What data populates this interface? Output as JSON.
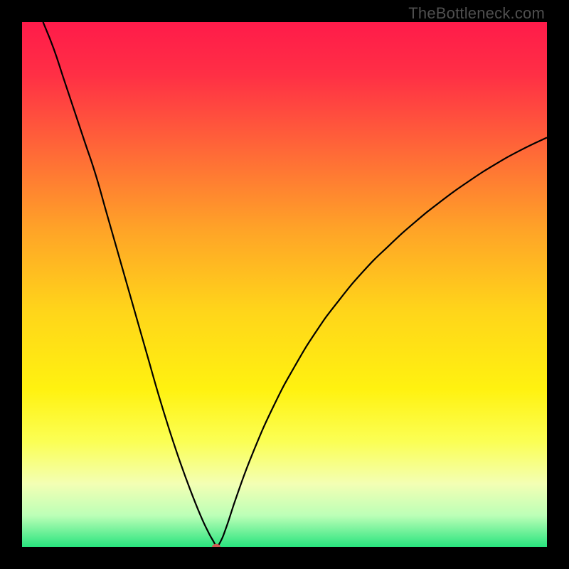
{
  "watermark": "TheBottleneck.com",
  "chart_data": {
    "type": "line",
    "title": "",
    "xlabel": "",
    "ylabel": "",
    "xlim": [
      0,
      100
    ],
    "ylim": [
      0,
      100
    ],
    "background_gradient": {
      "stops": [
        {
          "pct": 0,
          "color": "#ff1b4a"
        },
        {
          "pct": 10,
          "color": "#ff2f45"
        },
        {
          "pct": 25,
          "color": "#ff6a37"
        },
        {
          "pct": 40,
          "color": "#ffa527"
        },
        {
          "pct": 55,
          "color": "#ffd51a"
        },
        {
          "pct": 70,
          "color": "#fff210"
        },
        {
          "pct": 80,
          "color": "#fbff55"
        },
        {
          "pct": 88,
          "color": "#f3ffb4"
        },
        {
          "pct": 94,
          "color": "#bcffb7"
        },
        {
          "pct": 100,
          "color": "#28e47e"
        }
      ]
    },
    "series": [
      {
        "name": "curve-left",
        "x": [
          4,
          6,
          8,
          10,
          12,
          14,
          16,
          18,
          20,
          22,
          24,
          26,
          28,
          30,
          32,
          34,
          35.5,
          36.5,
          37
        ],
        "y": [
          100,
          95,
          89,
          83,
          77,
          71,
          64,
          57,
          50,
          43,
          36,
          29,
          22.5,
          16.5,
          11,
          6,
          2.8,
          1,
          0
        ]
      },
      {
        "name": "curve-right",
        "x": [
          37,
          37.8,
          39,
          41,
          44,
          48,
          52,
          56,
          60,
          65,
          70,
          75,
          80,
          85,
          90,
          95,
          100
        ],
        "y": [
          0,
          1,
          4,
          10,
          18,
          27,
          34.5,
          41,
          46.5,
          52.5,
          57.5,
          62,
          66,
          69.6,
          72.8,
          75.6,
          78
        ]
      }
    ],
    "marker": {
      "x": 37,
      "y": 0,
      "color": "#cf5b53",
      "rx": 6,
      "ry": 4.2
    }
  }
}
